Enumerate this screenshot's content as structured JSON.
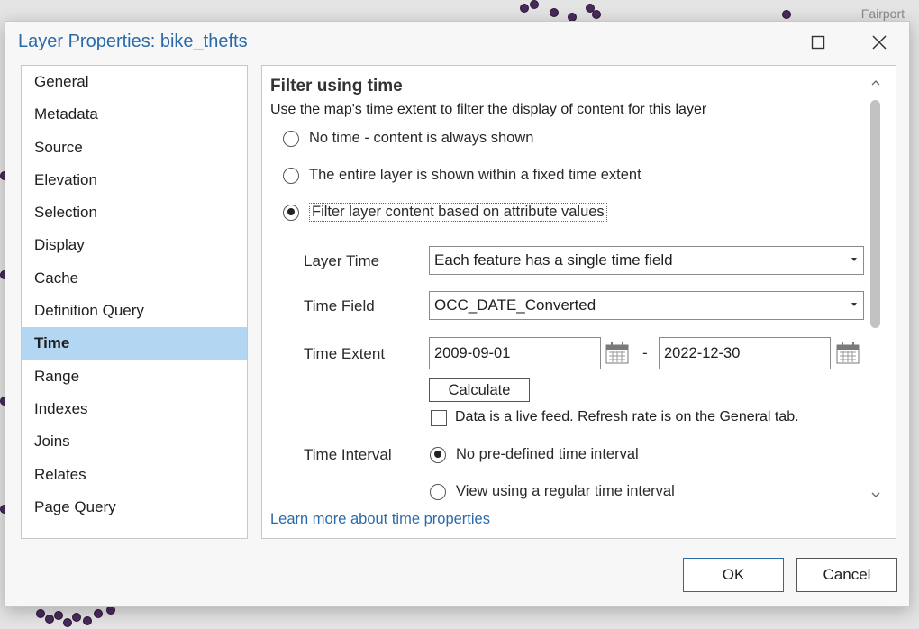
{
  "map": {
    "label": "Fairport"
  },
  "dialog": {
    "title": "Layer Properties: bike_thefts"
  },
  "nav": {
    "items": [
      "General",
      "Metadata",
      "Source",
      "Elevation",
      "Selection",
      "Display",
      "Cache",
      "Definition Query",
      "Time",
      "Range",
      "Indexes",
      "Joins",
      "Relates",
      "Page Query"
    ],
    "selected": "Time"
  },
  "content": {
    "heading": "Filter using time",
    "description": "Use the map's time extent to filter the display of content for this layer",
    "options": [
      {
        "label": "No time - content is always shown",
        "selected": false
      },
      {
        "label": "The entire layer is shown within a fixed time extent",
        "selected": false
      },
      {
        "label": "Filter layer content based on attribute values",
        "selected": true
      }
    ],
    "layer_time": {
      "label": "Layer Time",
      "value": "Each feature has a single time field"
    },
    "time_field": {
      "label": "Time Field",
      "value": "OCC_DATE_Converted"
    },
    "time_extent": {
      "label": "Time Extent",
      "start": "2009-09-01",
      "separator": "-",
      "end": "2022-12-30"
    },
    "calculate_label": "Calculate",
    "live_feed": {
      "label": "Data is a live feed. Refresh rate is on the General tab.",
      "checked": false
    },
    "time_interval": {
      "label": "Time Interval",
      "options": [
        {
          "label": "No pre-defined time interval",
          "selected": true
        },
        {
          "label": "View using a regular time interval",
          "selected": false
        }
      ]
    },
    "learn_more": "Learn more about time properties"
  },
  "footer": {
    "ok": "OK",
    "cancel": "Cancel"
  },
  "colors": {
    "accent": "#2b6aa8",
    "selected_nav": "#b3d7f3",
    "map_points": "#4a2a5c"
  }
}
